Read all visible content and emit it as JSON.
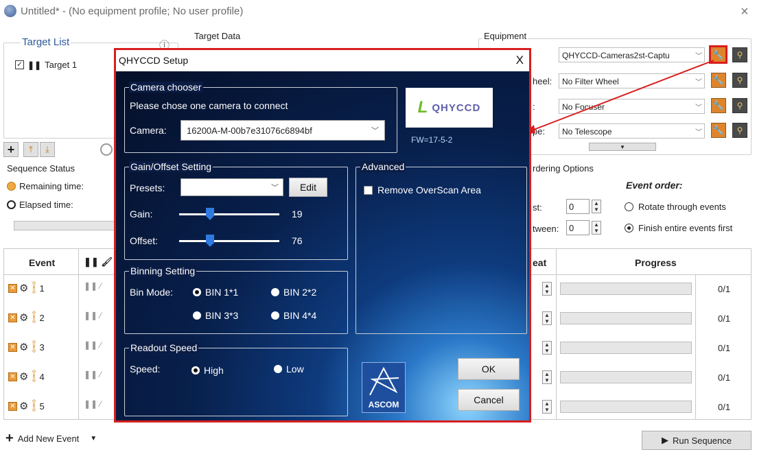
{
  "window": {
    "title": "Untitled* - (No equipment profile; No user profile)",
    "close": "×"
  },
  "target_list": {
    "title": "Target List",
    "info": "ⓘ",
    "items": [
      "Target 1"
    ]
  },
  "target_data": {
    "title": "Target Data"
  },
  "equipment": {
    "title": "Equipment",
    "rows": [
      {
        "label": "",
        "value": "QHYCCD-Cameras2st-Captu"
      },
      {
        "label": "heel:",
        "value": "No Filter Wheel"
      },
      {
        "label": ":",
        "value": "No Focuser"
      },
      {
        "label": "pe:",
        "value": "No Telescope"
      }
    ]
  },
  "sequence_status": {
    "title": "Sequence Status",
    "remaining": "Remaining time:",
    "elapsed": "Elapsed time:"
  },
  "ordering": {
    "title": "rdering Options",
    "event_order": "Event order:",
    "field1_label": "st:",
    "field1_value": "0",
    "field2_label": "tween:",
    "field2_value": "0",
    "opt_rotate": "Rotate through events",
    "opt_finish": "Finish entire events first"
  },
  "table": {
    "col_event": "Event",
    "col_repeat": "eat",
    "col_progress": "Progress",
    "rows": [
      {
        "num": "1",
        "progress": "0/1"
      },
      {
        "num": "2",
        "progress": "0/1"
      },
      {
        "num": "3",
        "progress": "0/1"
      },
      {
        "num": "4",
        "progress": "0/1"
      },
      {
        "num": "5",
        "progress": "0/1"
      }
    ]
  },
  "footer": {
    "add_event": "Add New Event",
    "run": "Run Sequence"
  },
  "dialog": {
    "title": "QHYCCD Setup",
    "close": "X",
    "camera_chooser": {
      "title": "Camera chooser",
      "prompt": "Please chose one camera to connect",
      "camera_label": "Camera:",
      "camera_value": "16200A-M-00b7e31076c6894bf"
    },
    "logo_text": "QHYCCD",
    "firmware": "FW=17-5-2",
    "gain_offset": {
      "title": "Gain/Offset Setting",
      "presets_label": "Presets:",
      "presets_value": "",
      "edit": "Edit",
      "gain_label": "Gain:",
      "gain_value": "19",
      "offset_label": "Offset:",
      "offset_value": "76"
    },
    "advanced": {
      "title": "Advanced",
      "remove_overscan": "Remove OverScan Area"
    },
    "binning": {
      "title": "Binning Setting",
      "label": "Bin Mode:",
      "options": [
        "BIN 1*1",
        "BIN 2*2",
        "BIN 3*3",
        "BIN 4*4"
      ],
      "selected": "BIN 1*1"
    },
    "readout": {
      "title": "Readout Speed",
      "label": "Speed:",
      "options": [
        "High",
        "Low"
      ],
      "selected": "High"
    },
    "ascom": "ASCOM",
    "ok": "OK",
    "cancel": "Cancel"
  },
  "colors": {
    "highlight_red": "#d81e1e",
    "wrench_orange": "#e0842c",
    "slider_blue": "#2f7ae0"
  }
}
